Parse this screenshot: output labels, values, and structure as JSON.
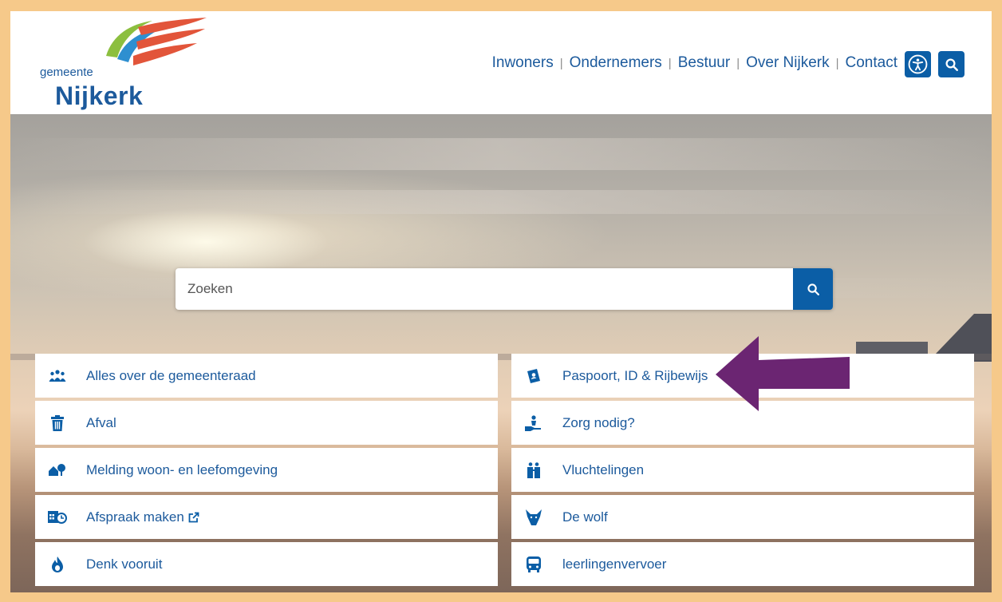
{
  "logo": {
    "small": "gemeente",
    "big": "Nijkerk"
  },
  "nav": {
    "items": [
      {
        "label": "Inwoners"
      },
      {
        "label": "Ondernemers"
      },
      {
        "label": "Bestuur"
      },
      {
        "label": "Over Nijkerk"
      },
      {
        "label": "Contact"
      }
    ],
    "separator": "|"
  },
  "search": {
    "placeholder": "Zoeken"
  },
  "tiles": {
    "left": [
      {
        "label": "Alles over de gemeenteraad",
        "icon": "people-group-icon"
      },
      {
        "label": "Afval",
        "icon": "trash-icon"
      },
      {
        "label": "Melding woon- en leefomgeving",
        "icon": "house-tree-icon"
      },
      {
        "label": "Afspraak maken",
        "icon": "calendar-clock-icon"
      },
      {
        "label": "Denk vooruit",
        "icon": "flame-icon"
      }
    ],
    "right": [
      {
        "label": "Paspoort, ID & Rijbewijs",
        "icon": "passport-icon"
      },
      {
        "label": "Zorg nodig?",
        "icon": "care-hand-icon"
      },
      {
        "label": "Vluchtelingen",
        "icon": "refugees-icon"
      },
      {
        "label": "De wolf",
        "icon": "wolf-icon"
      },
      {
        "label": "leerlingenvervoer",
        "icon": "bus-icon"
      }
    ]
  },
  "colors": {
    "primary": "#0b5ea6",
    "link": "#1c5a9c",
    "frame": "#f6c98a",
    "annotation_arrow": "#6b2572"
  }
}
